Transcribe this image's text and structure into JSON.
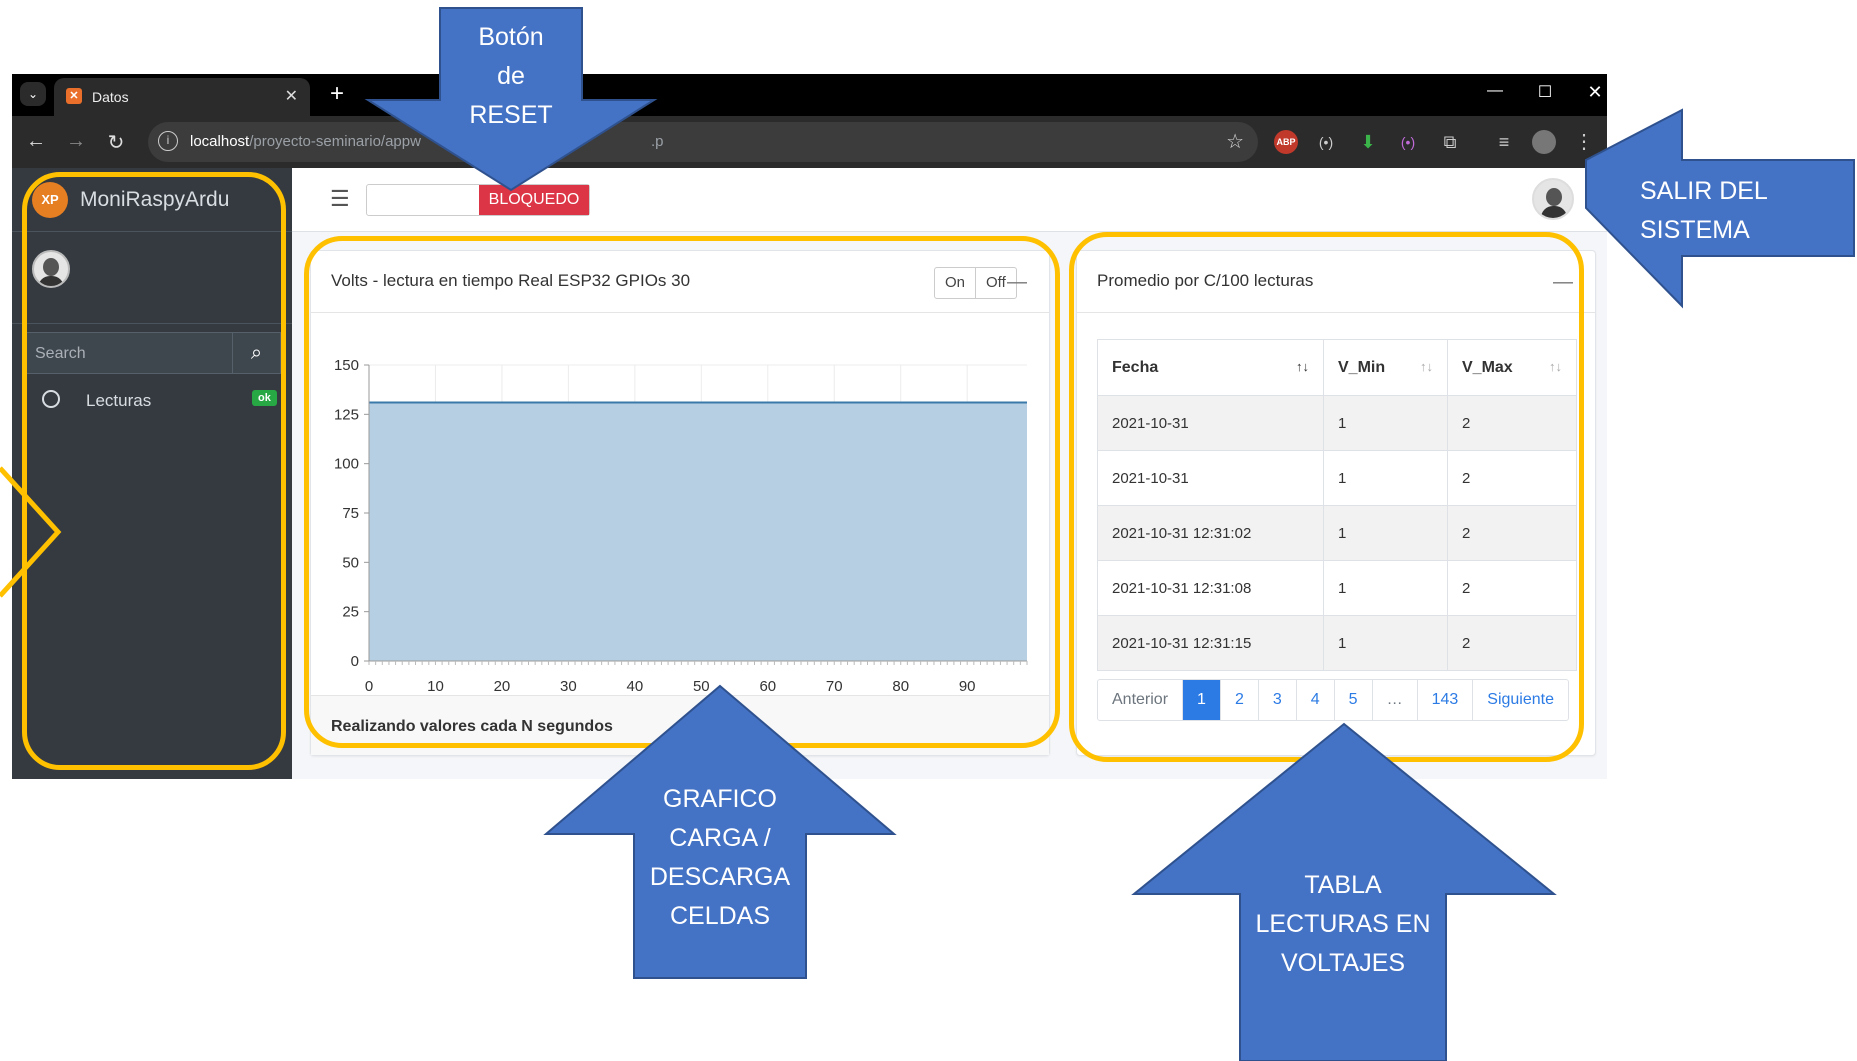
{
  "browser": {
    "tab_title": "Datos",
    "tab_favicon": "xampp-icon",
    "url_host": "localhost",
    "url_path": "/proyecto-seminario/appw",
    "url_tail": ".p"
  },
  "sidebar": {
    "brand_name": "MoniRaspyArdu",
    "brand_logo_text": "XP",
    "search_placeholder": "Search",
    "nav_items": [
      {
        "label": "Lecturas",
        "badge": "ok"
      }
    ]
  },
  "navbar": {
    "status_label": "BLOQUEDO"
  },
  "chart_card": {
    "title": "Volts - lectura en tiempo Real ESP32 GPIOs 30",
    "on_label": "On",
    "off_label": "Off",
    "footer": "Realizando valores cada N segundos"
  },
  "chart_data": {
    "type": "area",
    "x": [
      0,
      99
    ],
    "y": [
      131,
      131
    ],
    "xlim": [
      0,
      99
    ],
    "ylim": [
      0,
      150
    ],
    "xticks": [
      0,
      10,
      20,
      30,
      40,
      50,
      60,
      70,
      80,
      90
    ],
    "yticks": [
      0,
      25,
      50,
      75,
      100,
      125,
      150
    ],
    "title": "",
    "xlabel": "",
    "ylabel": "",
    "grid": true,
    "fill_color": "#b6cfe3",
    "line_color": "#3a79aa"
  },
  "table_card": {
    "title": "Promedio por C/100 lecturas",
    "columns": [
      "Fecha",
      "V_Min",
      "V_Max"
    ],
    "rows": [
      [
        "2021-10-31",
        "1",
        "2"
      ],
      [
        "2021-10-31",
        "1",
        "2"
      ],
      [
        "2021-10-31 12:31:02",
        "1",
        "2"
      ],
      [
        "2021-10-31 12:31:08",
        "1",
        "2"
      ],
      [
        "2021-10-31 12:31:15",
        "1",
        "2"
      ]
    ],
    "pager": {
      "prev": "Anterior",
      "pages": [
        "1",
        "2",
        "3",
        "4",
        "5",
        "…",
        "143"
      ],
      "active": "1",
      "next": "Siguiente"
    }
  },
  "annotations": {
    "reset": [
      "Botón",
      "de",
      "RESET"
    ],
    "salir": [
      "SALIR DEL",
      "SISTEMA"
    ],
    "grafico": [
      "GRAFICO",
      "CARGA /",
      "DESCARGA",
      "CELDAS"
    ],
    "tabla": [
      "TABLA",
      "LECTURAS EN",
      "VOLTAJES"
    ]
  },
  "colors": {
    "arrow_fill": "#4472c4",
    "highlight": "#ffc000",
    "sidebar_bg": "#343a40",
    "badge_ok": "#28a745",
    "reset_red": "#dc3545"
  }
}
